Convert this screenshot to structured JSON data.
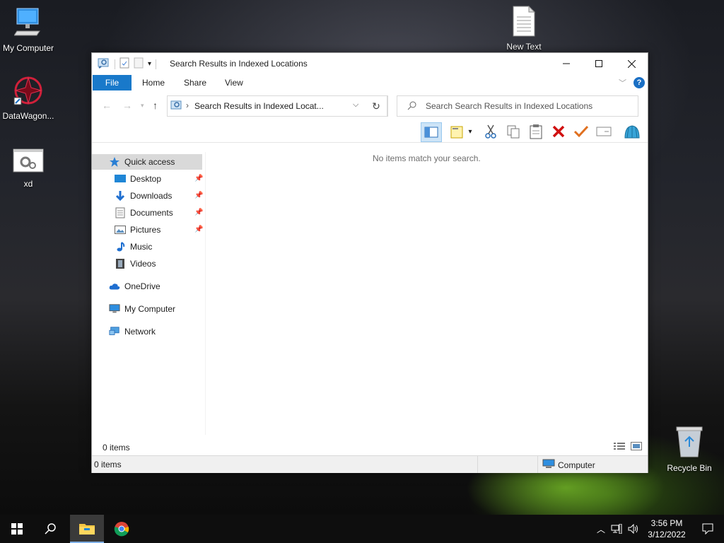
{
  "desktop": {
    "icons": [
      {
        "label": "My Computer"
      },
      {
        "label": "DataWagon..."
      },
      {
        "label": "xd"
      },
      {
        "label": "New Text"
      },
      {
        "label": "Recycle Bin"
      }
    ]
  },
  "window": {
    "title": "Search Results in Indexed Locations",
    "ribbon_tabs": {
      "file": "File",
      "home": "Home",
      "share": "Share",
      "view": "View"
    },
    "address": {
      "path": "Search Results in Indexed Locat..."
    },
    "search": {
      "placeholder": "Search Search Results in Indexed Locations"
    },
    "nav": {
      "quick_access": "Quick access",
      "desktop": "Desktop",
      "downloads": "Downloads",
      "documents": "Documents",
      "pictures": "Pictures",
      "music": "Music",
      "videos": "Videos",
      "onedrive": "OneDrive",
      "my_computer": "My Computer",
      "network": "Network"
    },
    "empty_message": "No items match your search.",
    "item_count": "0 items",
    "status": {
      "left": "0 items",
      "zone": "Computer"
    }
  },
  "taskbar": {
    "time": "3:56 PM",
    "date": "3/12/2022"
  },
  "colors": {
    "accent": "#1979ca",
    "taskbar": "#0e0e0e"
  }
}
